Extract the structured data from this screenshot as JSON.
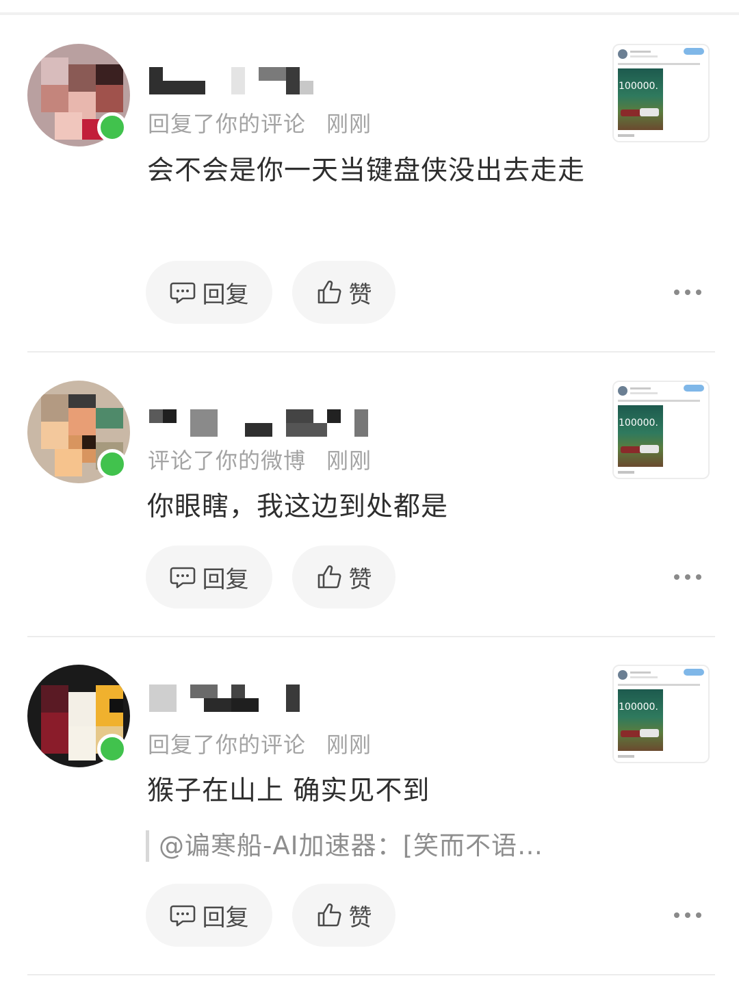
{
  "notifications": [
    {
      "action": "回复了你的评论",
      "time": "刚刚",
      "content": "会不会是你一天当键盘侠没出去走走",
      "quote": "",
      "reply_label": "回复",
      "like_label": "赞",
      "thumb_number": "100000."
    },
    {
      "action": "评论了你的微博",
      "time": "刚刚",
      "content": "你眼瞎，我这边到处都是",
      "quote": "",
      "reply_label": "回复",
      "like_label": "赞",
      "thumb_number": "100000."
    },
    {
      "action": "回复了你的评论",
      "time": "刚刚",
      "content": "猴子在山上 确实见不到",
      "quote": "@谝寒船-AI加速器：[笑而不语…",
      "reply_label": "回复",
      "like_label": "赞",
      "thumb_number": "100000."
    }
  ],
  "colors": {
    "online": "#41c24d",
    "meta_text": "#a3a3a3",
    "pill_bg": "#f5f5f5"
  },
  "icons": [
    "comment-icon",
    "thumbs-up-icon",
    "more-icon"
  ]
}
